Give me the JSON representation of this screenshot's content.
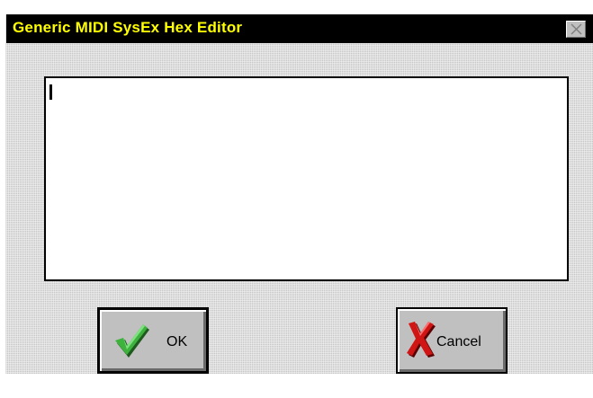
{
  "window": {
    "title": "Generic MIDI SysEx Hex Editor",
    "title_color": "#ffff00",
    "titlebar_color": "#000000",
    "close_icon": "close-icon"
  },
  "editor": {
    "value": ""
  },
  "buttons": {
    "ok_label": "OK",
    "ok_icon": "checkmark-icon",
    "cancel_label": "Cancel",
    "cancel_icon": "red-x-icon"
  }
}
